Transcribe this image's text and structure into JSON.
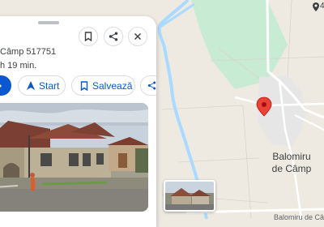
{
  "map": {
    "place_name_line1": "Balomiru",
    "place_name_line2": "de Câmp",
    "street_label": "Balomiru de Câmp",
    "corner_label": "4",
    "colors": {
      "land": "#eeeae2",
      "water": "#aadaff",
      "green": "#c8ebd4",
      "road": "#ffffff",
      "pin": "#ea4335"
    }
  },
  "panel": {
    "address": "Câmp 517751",
    "travel_time": "h 19 min.",
    "actions": {
      "start_label": "Start",
      "save_label": "Salvează"
    },
    "header_icons": [
      "bookmark-icon",
      "share-icon",
      "close-icon"
    ]
  }
}
